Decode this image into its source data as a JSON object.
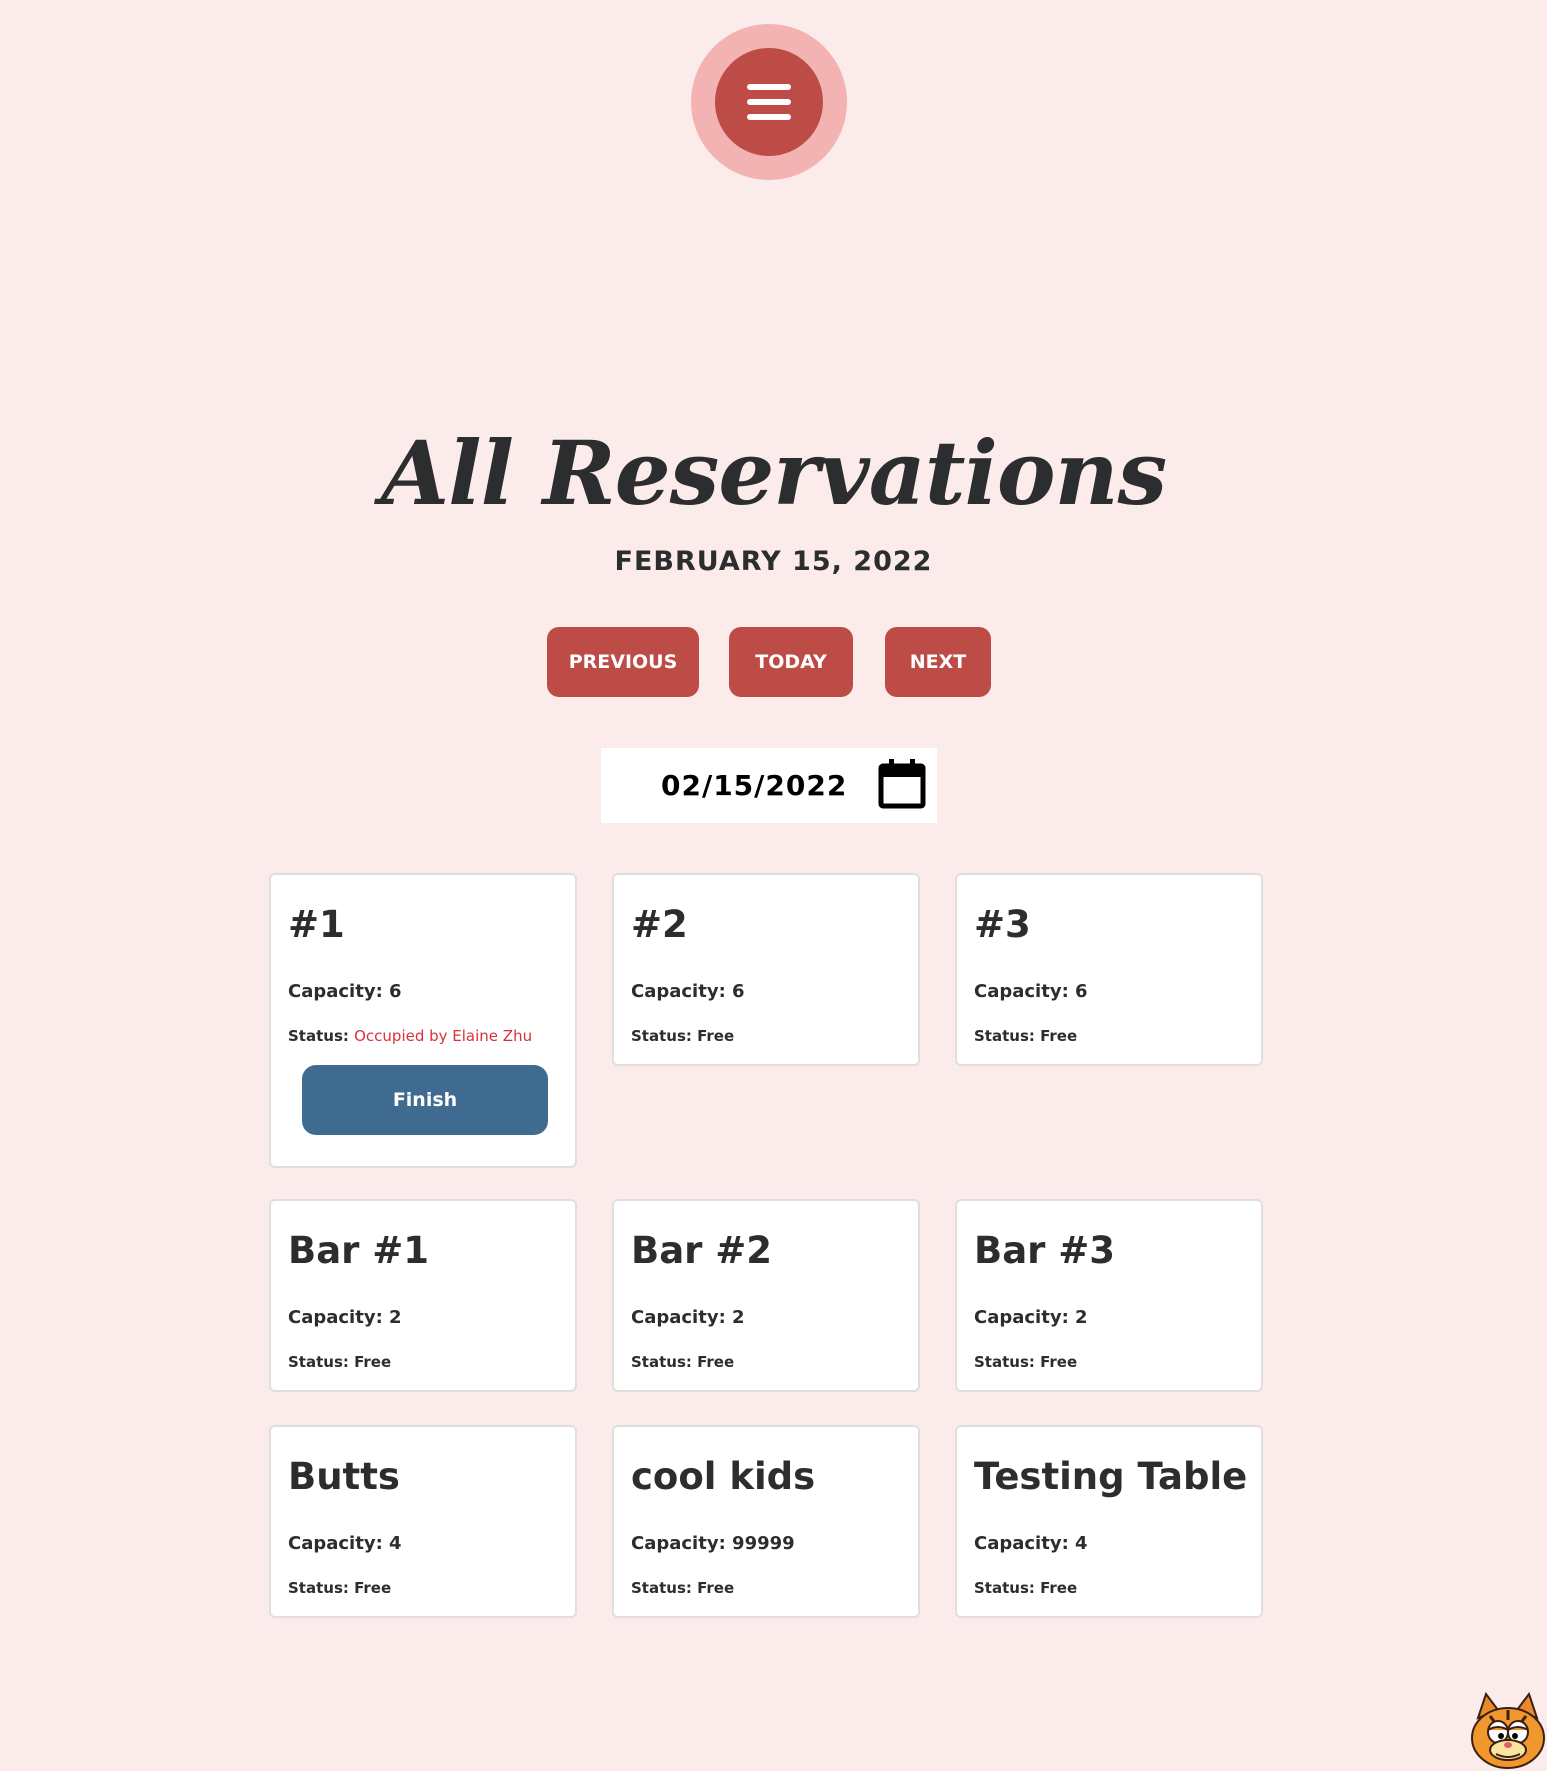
{
  "header": {
    "menu_icon": "hamburger-menu-icon"
  },
  "title": "All Reservations",
  "date_heading": "FEBRUARY 15, 2022",
  "nav": {
    "previous": "PREVIOUS",
    "today": "TODAY",
    "next": "NEXT"
  },
  "date_input": {
    "value": "02/15/2022",
    "icon": "calendar-icon"
  },
  "tables": [
    {
      "name": "#1",
      "capacity_label": "Capacity:",
      "capacity": "6",
      "status_label": "Status:",
      "status": "Occupied by Elaine Zhu",
      "action": "Finish"
    },
    {
      "name": "#2",
      "capacity_label": "Capacity:",
      "capacity": "6",
      "status_label": "Status:",
      "status": "Free"
    },
    {
      "name": "#3",
      "capacity_label": "Capacity:",
      "capacity": "6",
      "status_label": "Status:",
      "status": "Free"
    },
    {
      "name": "Bar #1",
      "capacity_label": "Capacity:",
      "capacity": "2",
      "status_label": "Status:",
      "status": "Free"
    },
    {
      "name": "Bar #2",
      "capacity_label": "Capacity:",
      "capacity": "2",
      "status_label": "Status:",
      "status": "Free"
    },
    {
      "name": "Bar #3",
      "capacity_label": "Capacity:",
      "capacity": "2",
      "status_label": "Status:",
      "status": "Free"
    },
    {
      "name": "Butts",
      "capacity_label": "Capacity:",
      "capacity": "4",
      "status_label": "Status:",
      "status": "Free"
    },
    {
      "name": "cool kids",
      "capacity_label": "Capacity:",
      "capacity": "99999",
      "status_label": "Status:",
      "status": "Free"
    },
    {
      "name": "Testing Table",
      "capacity_label": "Capacity:",
      "capacity": "4",
      "status_label": "Status:",
      "status": "Free"
    }
  ],
  "colors": {
    "background": "#fbebea",
    "accent": "#bd4b46",
    "accent_light": "#f2b3b2",
    "finish_button": "#3f6b90",
    "occupied_text": "#d9303a"
  },
  "mascot": "cat-mascot-icon"
}
